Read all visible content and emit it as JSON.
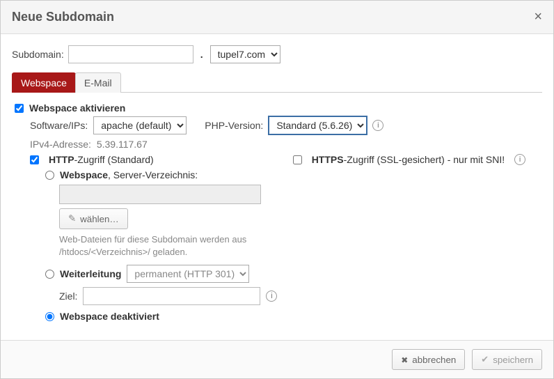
{
  "title": "Neue Subdomain",
  "subdomain": {
    "label": "Subdomain:",
    "value": "",
    "dot": ".",
    "domain_selected": "tupel7.com"
  },
  "tabs": {
    "webspace": "Webspace",
    "email": "E-Mail"
  },
  "webspace": {
    "activate_label": "Webspace aktivieren",
    "software_label": "Software/IPs:",
    "software_selected": "apache (default)",
    "php_label": "PHP-Version:",
    "php_selected": "Standard (5.6.26)",
    "ipv4_label": "IPv4-Adresse:",
    "ipv4_value": "5.39.117.67",
    "http": {
      "bold": "HTTP",
      "rest": "-Zugriff (Standard)"
    },
    "https": {
      "bold": "HTTPS",
      "rest": "-Zugriff (SSL-gesichert) - nur mit SNI!"
    },
    "radio_dir": {
      "bold": "Webspace",
      "rest": ", Server-Verzeichnis:"
    },
    "choose_label": "wählen…",
    "help_line1": "Web-Dateien für diese Subdomain werden aus",
    "help_line2": "/htdocs/<Verzeichnis>/ geladen.",
    "redirect_label": "Weiterleitung",
    "redirect_selected": "permanent (HTTP 301)",
    "target_label": "Ziel:",
    "deactivated_label": "Webspace deaktiviert"
  },
  "footer": {
    "cancel": "abbrechen",
    "save": "speichern"
  }
}
